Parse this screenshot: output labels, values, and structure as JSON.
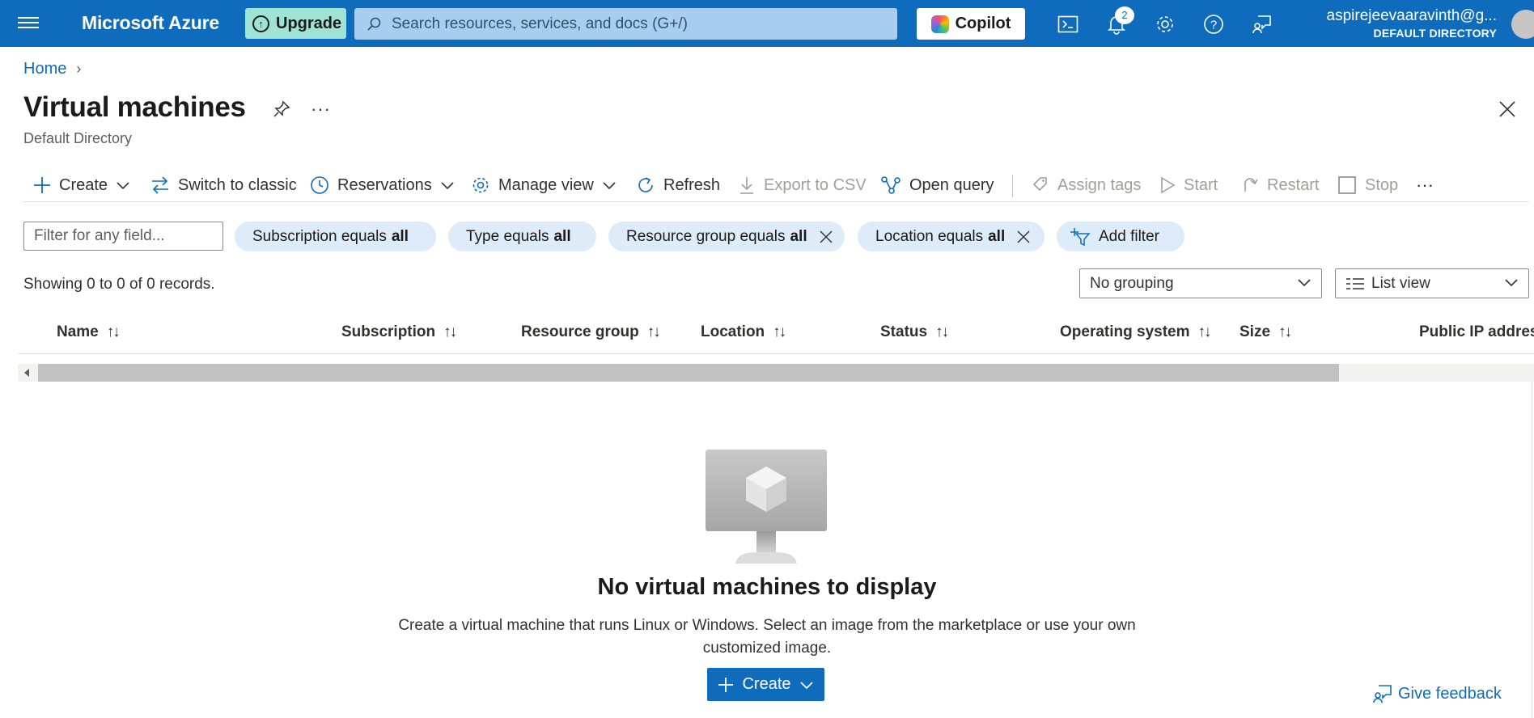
{
  "topbar": {
    "brand": "Microsoft Azure",
    "upgrade_label": "Upgrade",
    "search_placeholder": "Search resources, services, and docs (G+/)",
    "copilot_label": "Copilot",
    "notification_count": "2",
    "account_email": "aspirejeevaaravinth@g...",
    "account_directory": "DEFAULT DIRECTORY",
    "bg_color": "#0f6cbd"
  },
  "breadcrumb": {
    "home": "Home"
  },
  "header": {
    "title": "Virtual machines",
    "subtitle": "Default Directory",
    "more": "···"
  },
  "commands": {
    "create": "Create",
    "switch_classic": "Switch to classic",
    "reservations": "Reservations",
    "manage_view": "Manage view",
    "refresh": "Refresh",
    "export_csv": "Export to CSV",
    "open_query": "Open query",
    "assign_tags": "Assign tags",
    "start": "Start",
    "restart": "Restart",
    "stop": "Stop",
    "more": "···"
  },
  "filters": {
    "input_placeholder": "Filter for any field...",
    "subscription": {
      "label": "Subscription equals",
      "value": "all"
    },
    "type": {
      "label": "Type equals",
      "value": "all"
    },
    "resource_group": {
      "label": "Resource group equals",
      "value": "all"
    },
    "location": {
      "label": "Location equals",
      "value": "all"
    },
    "add_filter": "Add filter"
  },
  "records": {
    "summary": "Showing 0 to 0 of 0 records.",
    "grouping": "No grouping",
    "view": "List view"
  },
  "table": {
    "columns": [
      "Name",
      "Subscription",
      "Resource group",
      "Location",
      "Status",
      "Operating system",
      "Size",
      "Public IP addres"
    ],
    "sort_glyph": "↑↓",
    "rows": []
  },
  "empty_state": {
    "title": "No virtual machines to display",
    "description": "Create a virtual machine that runs Linux or Windows. Select an image from the marketplace or use your own customized image.",
    "create_label": "Create"
  },
  "feedback": {
    "label": "Give feedback"
  }
}
